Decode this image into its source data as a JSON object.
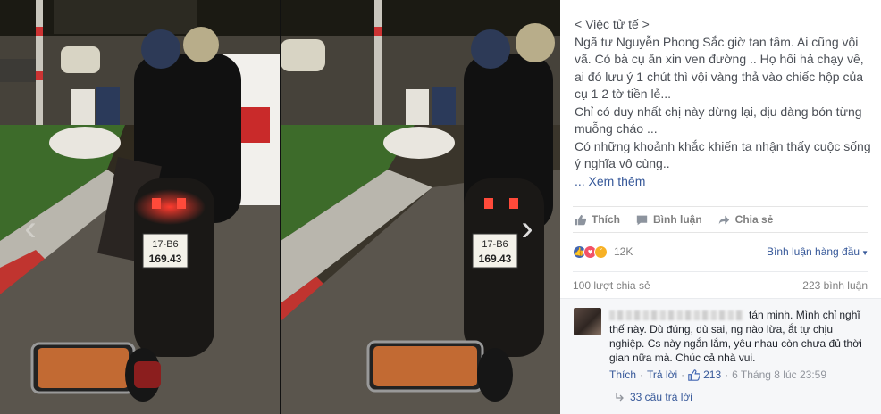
{
  "post": {
    "lines": [
      "< Việc tử tế >",
      "Ngã tư Nguyễn Phong Sắc giờ tan tầm. Ai cũng vội vã. Có bà cụ ăn xin ven đường .. Họ hối hả chạy về, ai đó lưu ý 1 chút thì vội vàng thả vào chiếc hộp của cụ 1 2 tờ tiền lẻ...",
      "Chỉ có duy nhất chị này dừng lại, dịu dàng bón từng muỗng cháo ...",
      "Có những khoảnh khắc khiến ta nhận thấy cuộc sống ý nghĩa vô cùng..",
      "... Xem thêm"
    ]
  },
  "actions": {
    "like": "Thích",
    "comment": "Bình luận",
    "share": "Chia sẻ"
  },
  "reactions": {
    "count": "12K",
    "sort_label": "Bình luận hàng đầu"
  },
  "stats": {
    "shares": "100 lượt chia sẻ",
    "comments": "223 bình luận"
  },
  "comment": {
    "text_visible": "tán minh. Mình chỉ nghĩ thế này. Dù đúng, dù sai, ng nào lừa, ắt tự chịu nghiệp. Cs này ngắn lắm, yêu nhau còn chưa đủ thời gian nữa mà. Chúc cả nhà vui.",
    "like_label": "Thích",
    "reply_label": "Trả lời",
    "like_count": "213",
    "time": "6 Tháng 8 lúc 23:59",
    "dot": "·"
  },
  "replies_label": "33 câu trả lời",
  "plate": {
    "top": "17-B6",
    "bottom": "169.43"
  },
  "colors": {
    "link": "#365899",
    "like_blue": "#4267b2",
    "love_red": "#f25268",
    "sad_yellow": "#f7b125"
  }
}
